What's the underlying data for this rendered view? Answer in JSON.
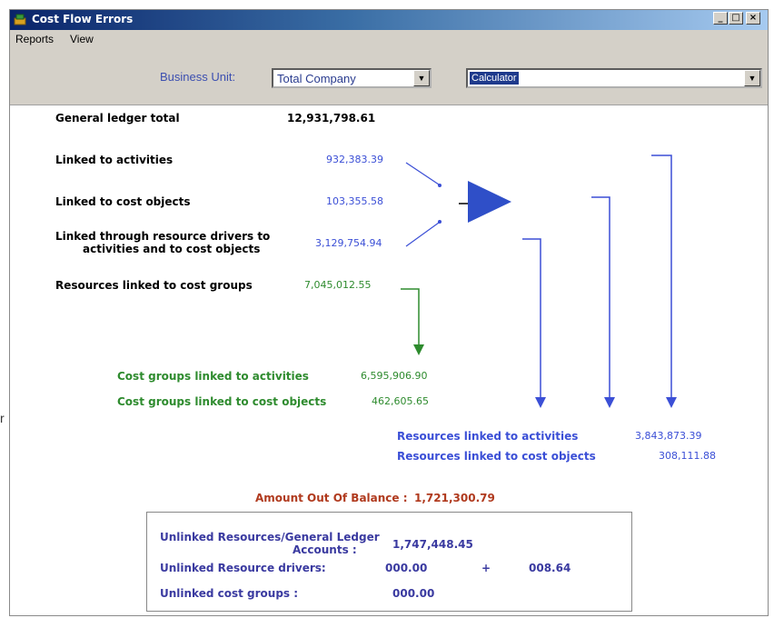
{
  "window": {
    "title": "Cost Flow Errors",
    "min_label": "_",
    "max_label": "□",
    "close_label": "×"
  },
  "menu": {
    "reports": "Reports",
    "view": "View"
  },
  "toolbar": {
    "business_unit_label": "Business Unit:",
    "business_unit_value": "Total Company",
    "model_value": "Calculator"
  },
  "ledger": {
    "gl_total_label": "General ledger total",
    "gl_total_value": "12,931,798.61",
    "linked_activities_label": "Linked to activities",
    "linked_activities_value": "932,383.39",
    "linked_cost_objects_label": "Linked to cost objects",
    "linked_cost_objects_value": "103,355.58",
    "linked_drivers_label_1": "Linked through resource drivers to",
    "linked_drivers_label_2": "activities and to cost objects",
    "linked_drivers_value": "3,129,754.94",
    "cost_groups_label": "Resources linked  to cost groups",
    "cost_groups_value": "7,045,012.55"
  },
  "groups": {
    "cg_activities_label": "Cost groups linked to activities",
    "cg_activities_value": "6,595,906.90",
    "cg_cost_objects_label": "Cost groups linked to cost objects",
    "cg_cost_objects_value": "462,605.65"
  },
  "resources": {
    "res_activities_label": "Resources linked to activities",
    "res_activities_value": "3,843,873.39",
    "res_cost_objects_label": "Resources  linked to cost objects",
    "res_cost_objects_value": "308,111.88"
  },
  "balance": {
    "label": "Amount Out Of Balance :",
    "value": "1,721,300.79"
  },
  "unlinked": {
    "resources_label_1": "Unlinked Resources/General Ledger",
    "resources_label_2": "Accounts :",
    "resources_value": "1,747,448.45",
    "drivers_label": "Unlinked Resource drivers:",
    "drivers_value": "000.00",
    "plus": "+",
    "drivers_value_2": "008.64",
    "cost_groups_label": "Unlinked cost groups :",
    "cost_groups_value": "000.00"
  },
  "stray_char": "r",
  "colors": {
    "blue": "#3b4fd6",
    "green": "#2e8b2e",
    "red": "#b03a1e",
    "triangle": "#2f4fc8"
  },
  "icons": {
    "app": "money-bag-icon"
  }
}
